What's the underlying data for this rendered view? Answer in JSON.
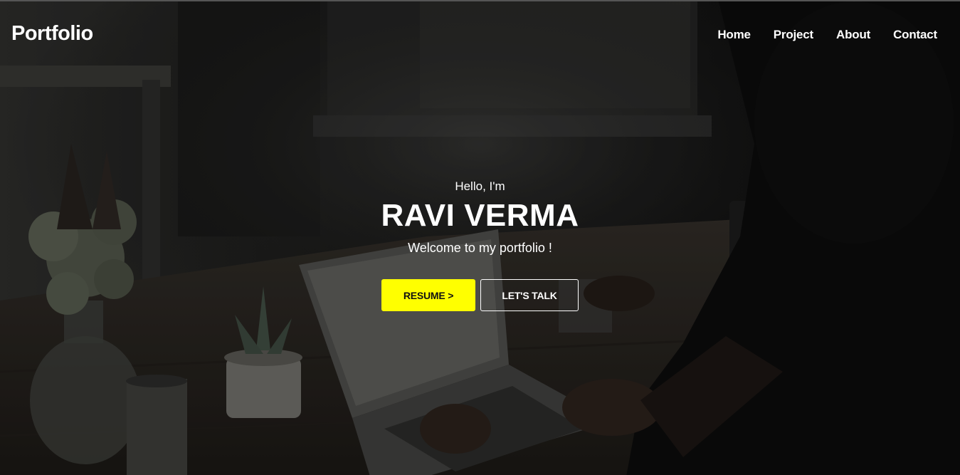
{
  "navbar": {
    "logo": "Portfolio",
    "links": [
      "Home",
      "Project",
      "About",
      "Contact"
    ]
  },
  "hero": {
    "greeting": "Hello, I'm",
    "name": "RAVI VERMA",
    "tagline": "Welcome to my portfolio !",
    "buttons": {
      "resume": "RESUME >",
      "talk": "LET'S TALK"
    }
  },
  "colors": {
    "accent": "#ffff00",
    "text": "#ffffff",
    "background": "#0a0a0a"
  }
}
